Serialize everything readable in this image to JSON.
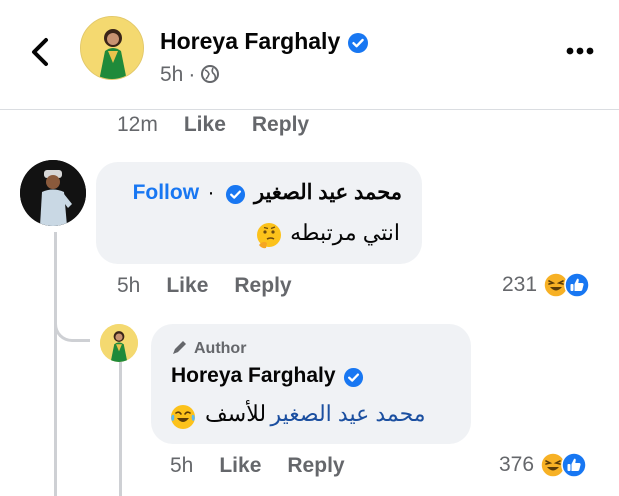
{
  "header": {
    "name": "Horeya Farghaly",
    "time": "5h",
    "separator": "·",
    "privacy_icon": "globe-icon",
    "back_icon": "chevron-left-icon",
    "more_icon": "more-horizontal-icon"
  },
  "prev_comment_actions": {
    "time": "12m",
    "like": "Like",
    "reply": "Reply"
  },
  "comment": {
    "follow_label": "Follow",
    "separator": "·",
    "author": "محمد عيد الصغير",
    "text": "انتي مرتبطه",
    "emoji": "thinking-face-icon",
    "time": "5h",
    "like": "Like",
    "reply": "Reply",
    "reaction_count": "231",
    "reactions": [
      "laughing-face-icon",
      "thumbs-up-icon"
    ]
  },
  "reply": {
    "badge": "Author",
    "badge_icon": "pencil-icon",
    "author": "Horeya Farghaly",
    "mention": "محمد عيد الصغير",
    "text": "للأسف",
    "emoji": "tears-of-joy-icon",
    "time": "5h",
    "like": "Like",
    "reply": "Reply",
    "reaction_count": "376",
    "reactions": [
      "laughing-face-icon",
      "thumbs-up-icon"
    ]
  },
  "colors": {
    "accent": "#1877f2",
    "bubble": "#f0f2f5",
    "meta": "#65676b",
    "mention": "#1b4fa0"
  }
}
